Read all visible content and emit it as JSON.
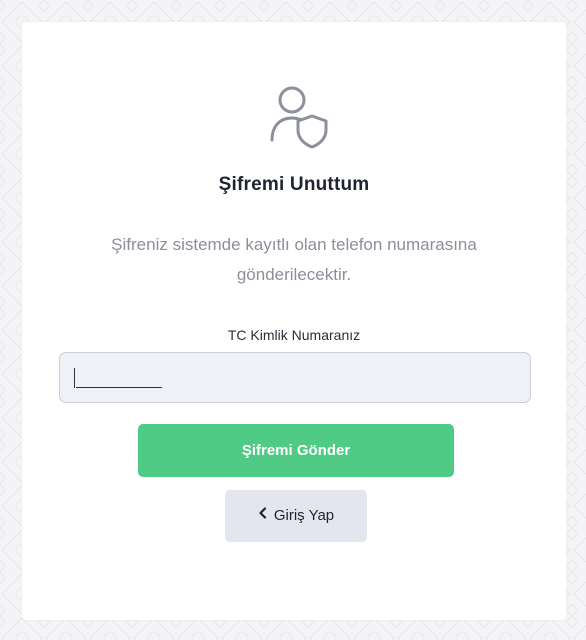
{
  "page": {
    "title": "Şifremi Unuttum",
    "description": "Şifreniz sistemde kayıtlı olan telefon numarasına gönderilecektir.",
    "icon": "user-shield-icon"
  },
  "form": {
    "tc_label": "TC Kimlik Numaranız",
    "tc_value": "",
    "tc_placeholder": ""
  },
  "buttons": {
    "submit_label": "Şifremi Gönder",
    "back_label": "Giriş Yap",
    "back_icon": "chevron-left-icon"
  },
  "colors": {
    "primary": "#4fcb85",
    "secondary": "#e3e6ee",
    "input_bg": "#eef1f6",
    "title": "#1f2430",
    "muted_text": "#8a8f99"
  }
}
